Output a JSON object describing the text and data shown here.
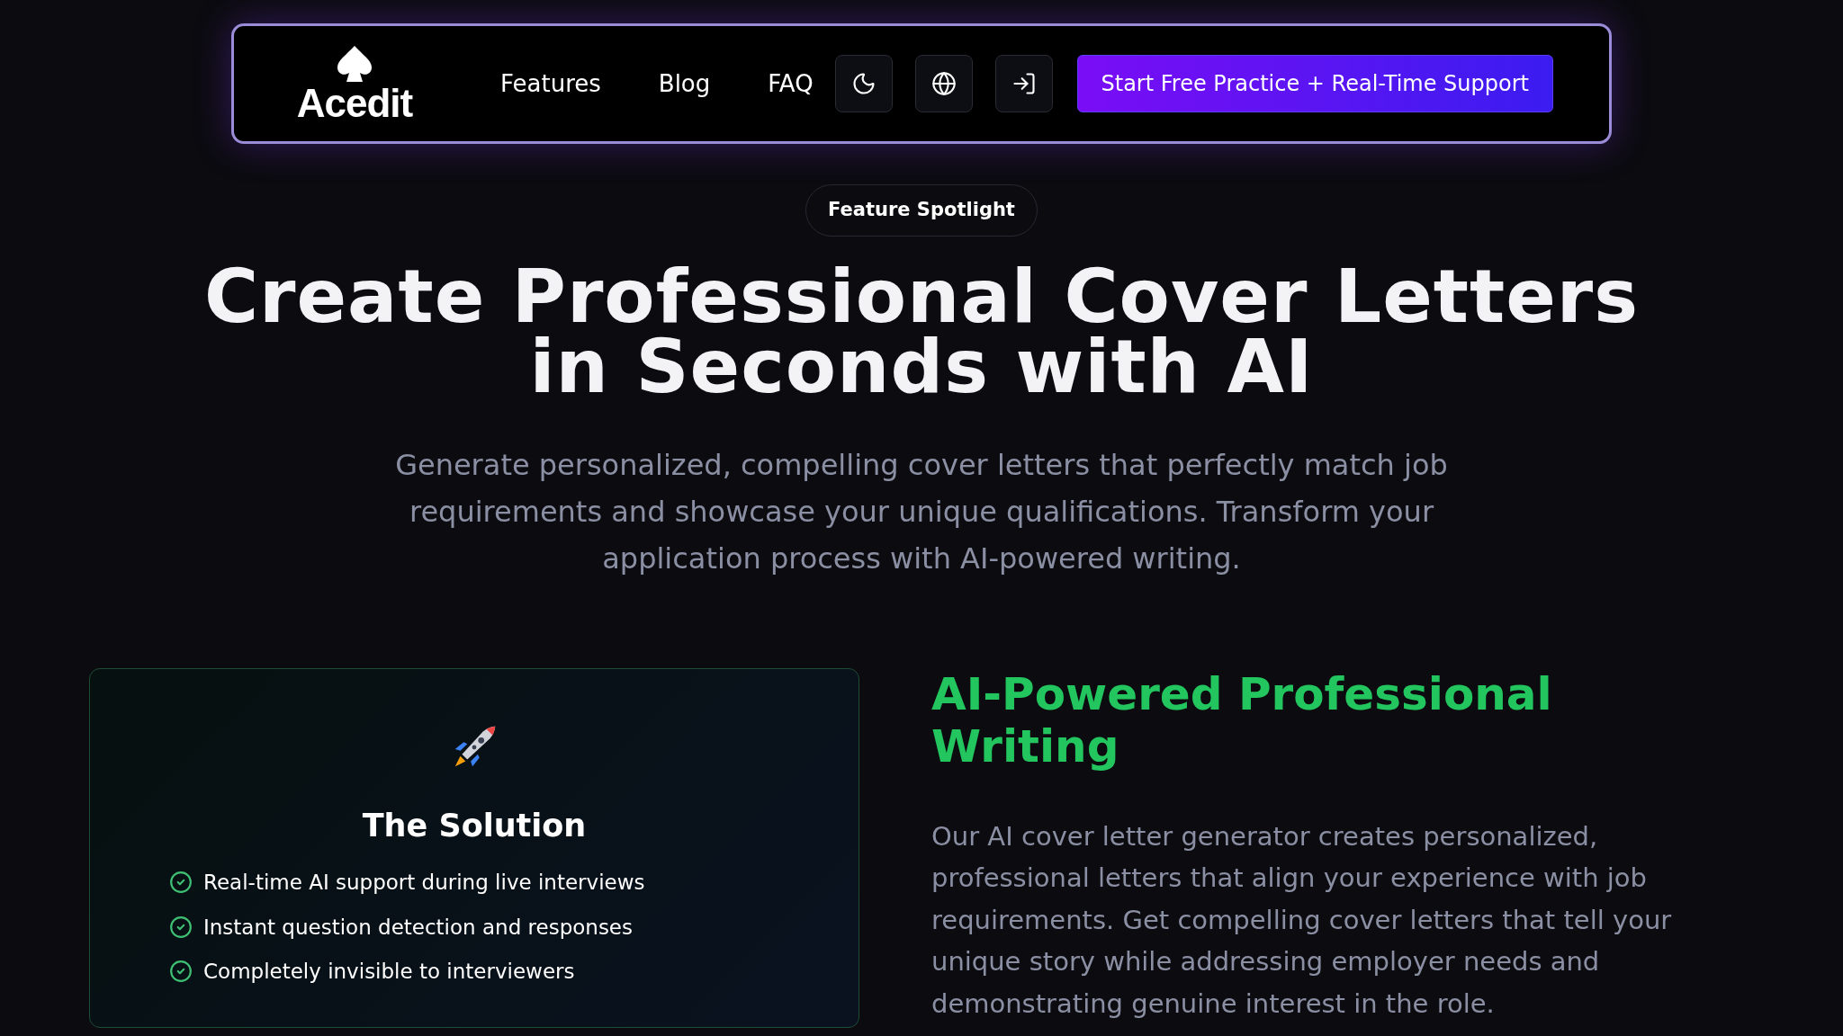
{
  "nav": {
    "logo": "Acedit",
    "links": [
      "Features",
      "Blog",
      "FAQ"
    ],
    "icon_buttons": [
      {
        "kind": "moon"
      },
      {
        "kind": "globe"
      },
      {
        "kind": "login"
      }
    ],
    "cta": "Start Free Practice + Real-Time Support"
  },
  "badge": "Feature Spotlight",
  "hero": {
    "title": "Create Professional Cover Letters in Seconds with AI",
    "subtitle": "Generate personalized, compelling cover letters that perfectly match job requirements and showcase your unique qualifications. Transform your application process with AI-powered writing."
  },
  "solution_card": {
    "title": "The Solution",
    "items": [
      "Real-time AI support during live interviews",
      "Instant question detection and responses",
      "Completely invisible to interviewers"
    ]
  },
  "feature": {
    "title": "AI-Powered Professional Writing",
    "body": "Our AI cover letter generator creates personalized, professional letters that align your experience with job requirements. Get compelling cover letters that tell your unique story while addressing employer needs and demonstrating genuine interest in the role."
  }
}
